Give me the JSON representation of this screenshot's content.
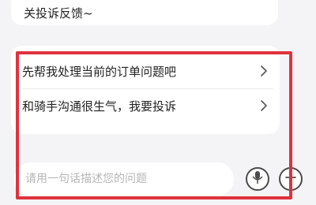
{
  "chat": {
    "top_message": "关投诉反馈~"
  },
  "suggestions": {
    "items": [
      {
        "label": "先帮我处理当前的订单问题吧",
        "icon": "chevron-right-icon"
      },
      {
        "label": "和骑手沟通很生气，我要投诉",
        "icon": "chevron-right-icon"
      }
    ]
  },
  "composer": {
    "placeholder": "请用一句话描述您的问题",
    "value": "",
    "mic_icon": "microphone-icon",
    "plus_icon": "plus-icon"
  },
  "colors": {
    "background": "#f4f4f6",
    "card": "#ffffff",
    "highlight": "#e0323d",
    "text": "#222222",
    "placeholder": "#b5b5b5"
  }
}
